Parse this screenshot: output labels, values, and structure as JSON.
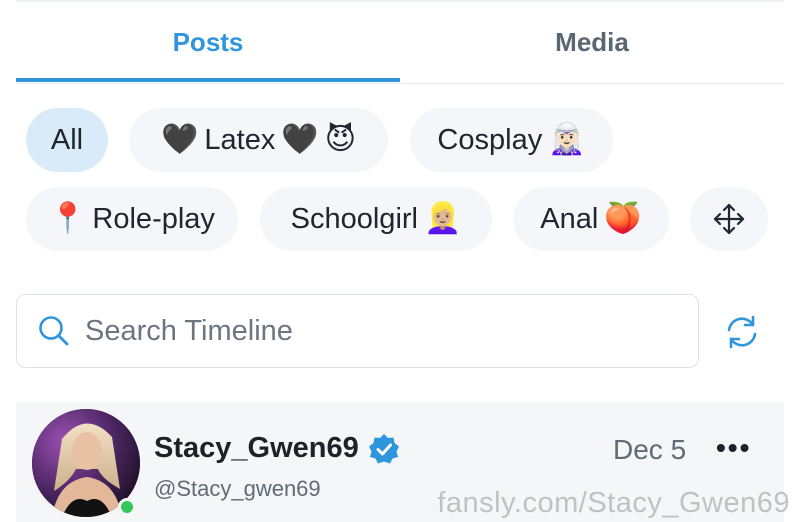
{
  "tabs": [
    {
      "label": "Posts",
      "active": true
    },
    {
      "label": "Media",
      "active": false
    }
  ],
  "filters": {
    "all": "All",
    "latex": "Latex",
    "cosplay": "Cosplay",
    "roleplay": "Role-play",
    "schoolgirl": "Schoolgirl",
    "anal": "Anal",
    "move_icon": "move-arrows-icon"
  },
  "emoji": {
    "black_heart": "🖤",
    "devil": "😈",
    "elf": "🧝🏻‍♀️",
    "pin": "📍",
    "girl": "👱🏼‍♀️",
    "peach": "🍑"
  },
  "search": {
    "placeholder": "Search Timeline",
    "icon": "search-icon",
    "refresh_icon": "refresh-icon"
  },
  "post": {
    "display_name": "Stacy_Gwen69",
    "handle": "@Stacy_gwen69",
    "date": "Dec 5",
    "more": "•••",
    "verified": true,
    "online": true
  },
  "watermark": "fansly.com/Stacy_Gwen69",
  "colors": {
    "accent": "#2f95dc",
    "chip_bg": "#f4f6f9",
    "chip_selected_bg": "#d9ebf8",
    "online": "#34c759"
  }
}
